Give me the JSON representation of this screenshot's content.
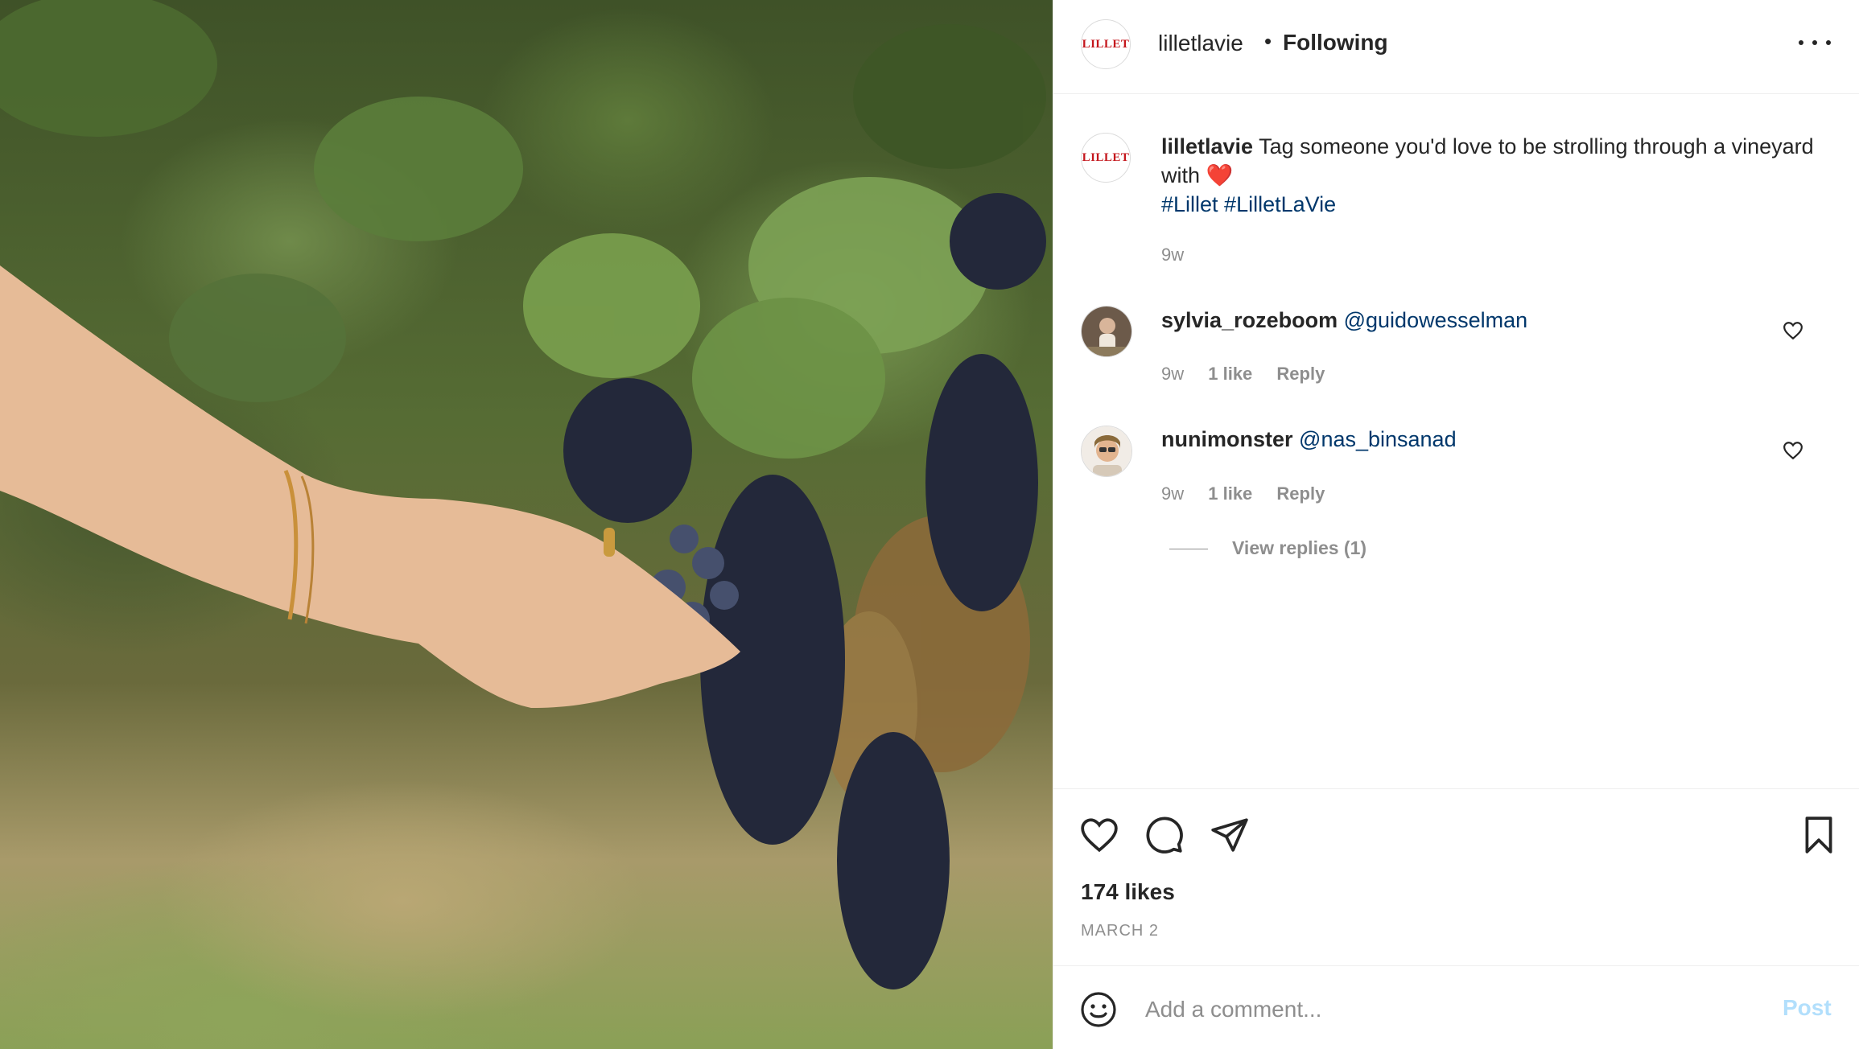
{
  "post": {
    "image_alt": "Hand holding a cluster of dark grapes in a vineyard",
    "account": {
      "username": "lilletlavie",
      "follow_status": "Following",
      "logo_text": "LILLET"
    },
    "caption": {
      "username": "lilletlavie",
      "text": " Tag someone you'd love to be strolling through a vineyard with ",
      "emoji": "❤️",
      "hashtags": "#Lillet #LilletLaVie",
      "time": "9w"
    },
    "comments": [
      {
        "username": "sylvia_rozeboom",
        "mention": "@guidowesselman",
        "time": "9w",
        "likes": "1 like",
        "reply": "Reply"
      },
      {
        "username": "nunimonster",
        "mention": "@nas_binsanad",
        "time": "9w",
        "likes": "1 like",
        "reply": "Reply"
      }
    ],
    "view_replies": "View replies (1)",
    "likes": "174 likes",
    "date": "MARCH 2",
    "composer": {
      "placeholder": "Add a comment...",
      "post_label": "Post"
    }
  },
  "colors": {
    "link": "#00376b",
    "muted": "#8e8e8e",
    "post_disabled": "#b2dffc",
    "brand": "#c4161c"
  }
}
